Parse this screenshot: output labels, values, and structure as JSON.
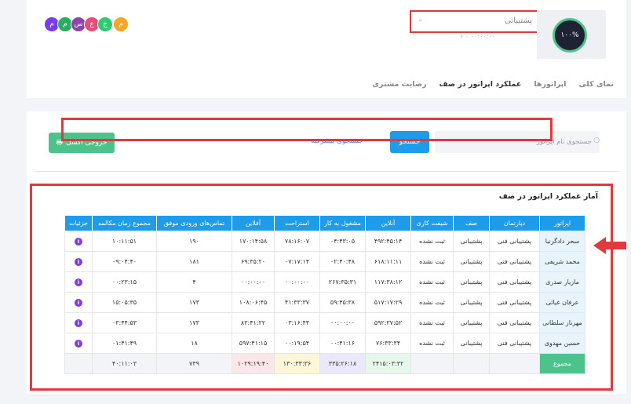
{
  "header": {
    "queue_select": {
      "value": "پشتیبانی"
    },
    "mini_stats": "۶ ۰ ۰۰:۰۰:۰۰",
    "gauge_value": "۱۰۰%",
    "avatars": [
      "م",
      "ح",
      "ع",
      "س",
      "م",
      "م"
    ],
    "tabs": [
      "نمای کلی",
      "اپراتورها",
      "عملکرد اپراتور در صف",
      "رضایت مشتری"
    ],
    "active_tab_index": 2
  },
  "toolbar": {
    "excel_label": "خروجی اکسل",
    "advanced_search_label": "جستجوی پیشرفته",
    "search_button_label": "جستجو",
    "search_placeholder": "جستجوی نام اپراتور"
  },
  "stats": {
    "title": "آمار عملکرد اپراتور در صف",
    "columns": [
      "اپراتور",
      "دپارتمان",
      "صف",
      "شیفت کاری",
      "آنلاین",
      "مشغول به کار",
      "استراحت",
      "آفلاین",
      "تماس‌های ورودی موفق",
      "مجموع زمان مکالمه",
      "جزئیات"
    ],
    "rows": [
      [
        "سحر دادگرنیا",
        "پشتیبانی فنی",
        "پشتیبانی",
        "ثبت نشده",
        "۴۹۲:۴۵:۱۴",
        "۰۴:۴۳:۰۵",
        "۷۸:۱۶:۰۷",
        "۱۷۰:۱۴:۵۸",
        "۱۹۰",
        "۱۰:۱۱:۵۱"
      ],
      [
        "محمد شریفی",
        "پشتیبانی فنی",
        "پشتیبانی",
        "ثبت نشده",
        "۶۱۸:۱۱:۱۱",
        "۰۲:۴۰:۴۸",
        "۰۷:۱۷:۱۴",
        "۶۹:۳۵:۲۰",
        "۱۸۱",
        "۰۹:۰۴:۴۰"
      ],
      [
        "مازیار صدری",
        "پشتیبانی فنی",
        "پشتیبانی",
        "ثبت نشده",
        "۱۱۷:۳۸:۱۲",
        "۲۶۷:۳۵:۳۱",
        "۰۰:۰۰:۰۰",
        "۰۰:۰۰:۰۰",
        "۴",
        "۰۰:۲۳:۱۵"
      ],
      [
        "عرفان غیاثی",
        "پشتیبانی فنی",
        "پشتیبانی",
        "ثبت نشده",
        "۵۱۷:۱۷:۲۹",
        "۵۹:۴۵:۳۸",
        "۴۱:۳۳:۳۷",
        "۱۰۸:۰۶:۴۵",
        "۱۷۳",
        "۱۵:۰۵:۳۵"
      ],
      [
        "مهرناز سلطانی",
        "پشتیبانی فنی",
        "پشتیبانی",
        "ثبت نشده",
        "۵۹۲:۳۷:۵۲",
        "۰۰:۰۰:۰۰",
        "۰۳:۱۶:۴۴",
        "۸۳:۴۱:۲۲",
        "۱۷۳",
        "۰۳:۴۴:۵۳"
      ],
      [
        "حسین مهدوی",
        "پشتیبانی فنی",
        "پشتیبانی",
        "ثبت نشده",
        "۷۶:۳۳:۳۴",
        "۰۰:۴۱:۱۶",
        "۰۰:۱۹:۵۴",
        "۵۹۷:۴۱:۱۵",
        "۱۸",
        "۰۱:۴۱:۴۹"
      ]
    ],
    "total": {
      "label": "مجموع",
      "online": "۲۴۱۵:۰۳:۳۲",
      "busy": "۳۳۵:۲۶:۱۸",
      "rest": "۱۳۰:۳۳:۳۶",
      "offline": "۱۰۲۹:۱۹:۴۰",
      "calls": "۷۳۹",
      "talk_time": "۴۰:۱۱:۰۳"
    },
    "info_glyph": "i"
  }
}
